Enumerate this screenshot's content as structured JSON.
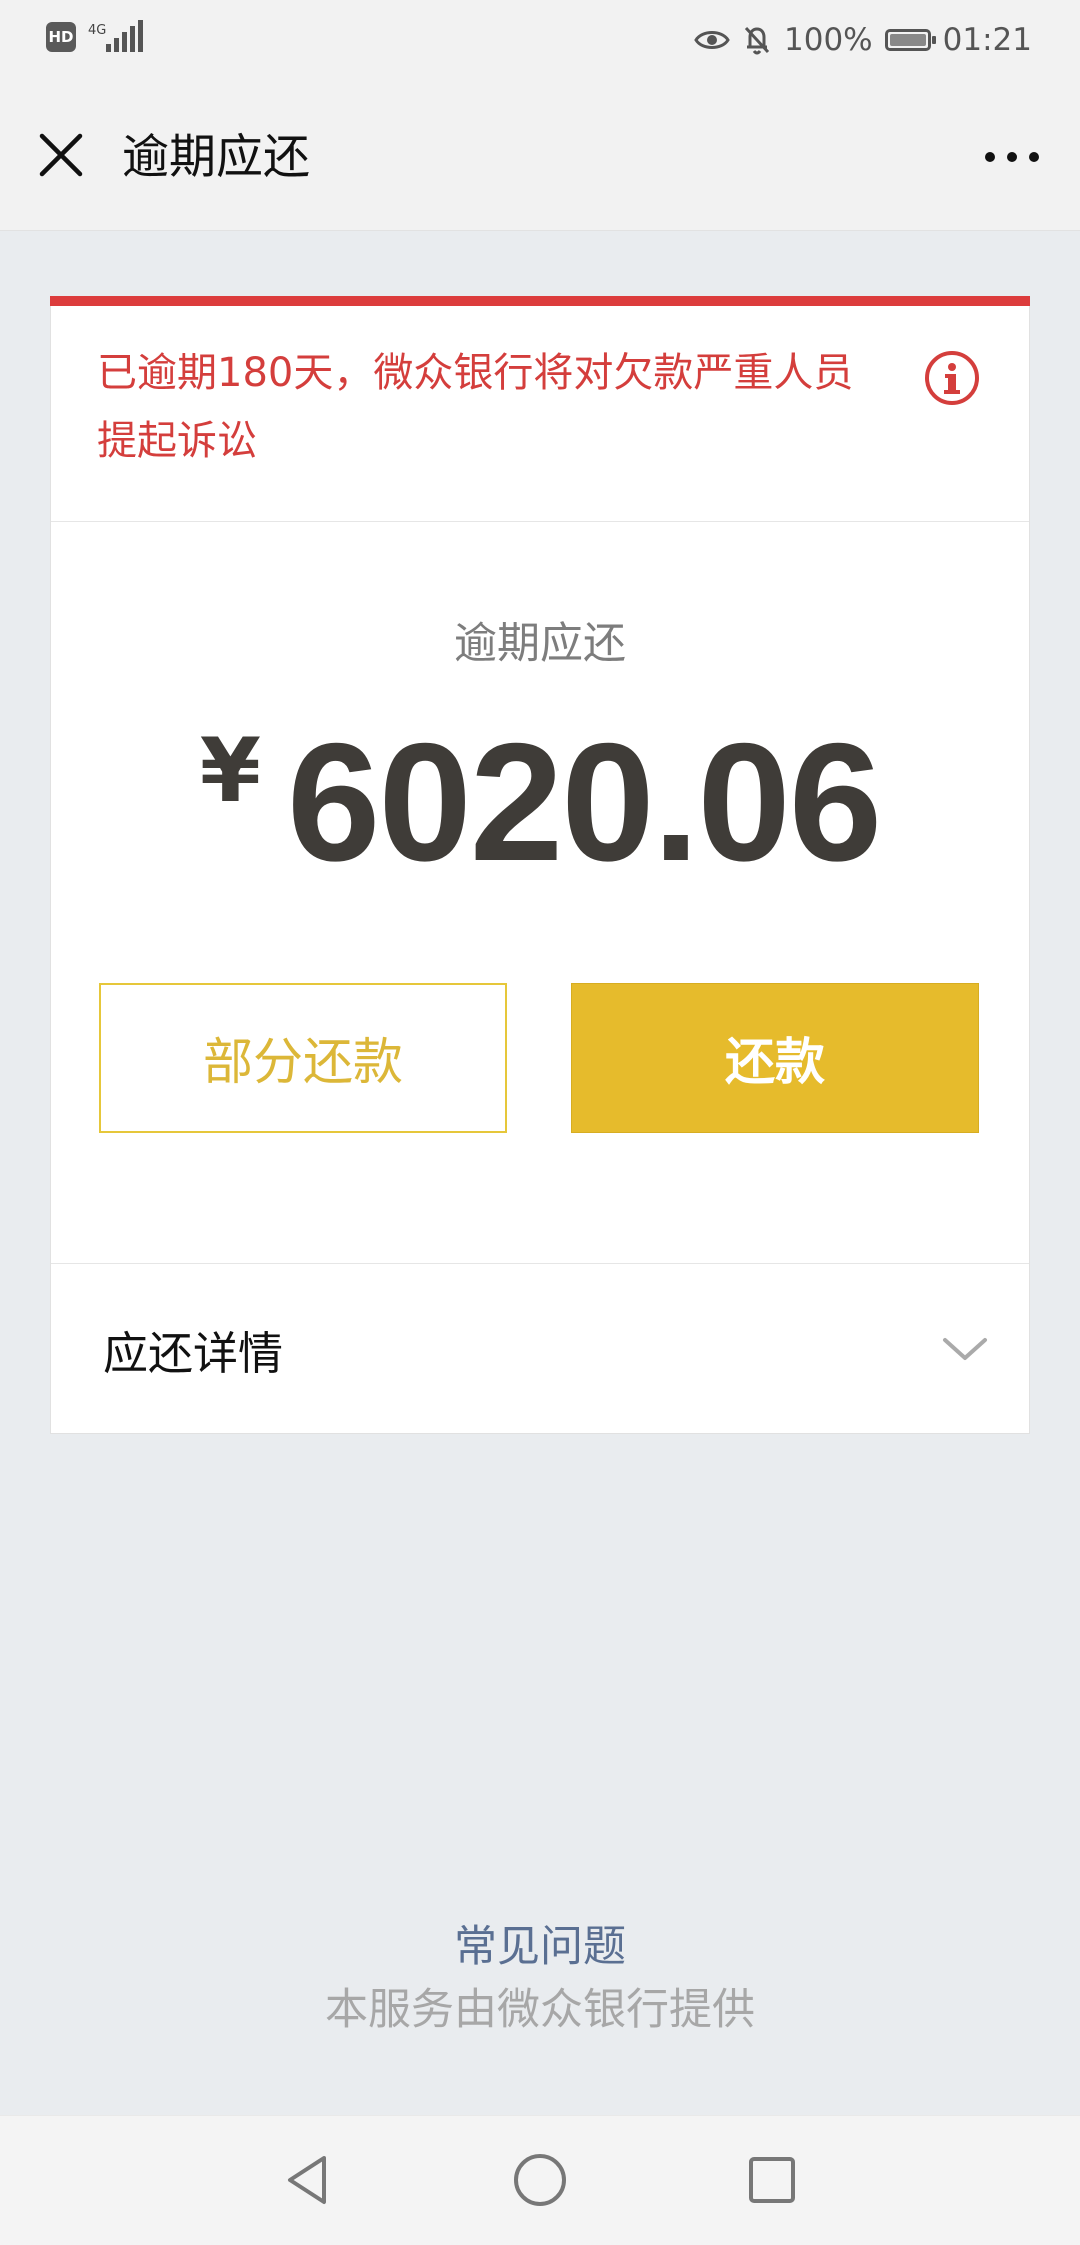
{
  "status_bar": {
    "hd": "HD",
    "network": "4G",
    "battery_percent": "100%",
    "battery_level": 1.0,
    "time": "01:21",
    "icons": [
      "eye-icon",
      "bell-off-icon",
      "battery-icon",
      "signal-icon"
    ]
  },
  "nav": {
    "title": "逾期应还",
    "close_icon": "close-icon",
    "more_icon": "more-icon"
  },
  "alert": {
    "text": "已逾期180天，微众银行将对欠款严重人员提起诉讼",
    "icon": "info-icon",
    "color": "#d43e3c"
  },
  "amount": {
    "label": "逾期应还",
    "currency": "¥",
    "value": "6020.06"
  },
  "actions": {
    "partial_label": "部分还款",
    "pay_label": "还款",
    "accent_color": "#e6bb2c"
  },
  "details": {
    "label": "应还详情",
    "icon": "chevron-down-icon"
  },
  "footer": {
    "faq": "常见问题",
    "provider": "本服务由微众银行提供"
  },
  "system_nav": {
    "back_icon": "back-icon",
    "home_icon": "home-icon",
    "recents_icon": "recents-icon"
  }
}
